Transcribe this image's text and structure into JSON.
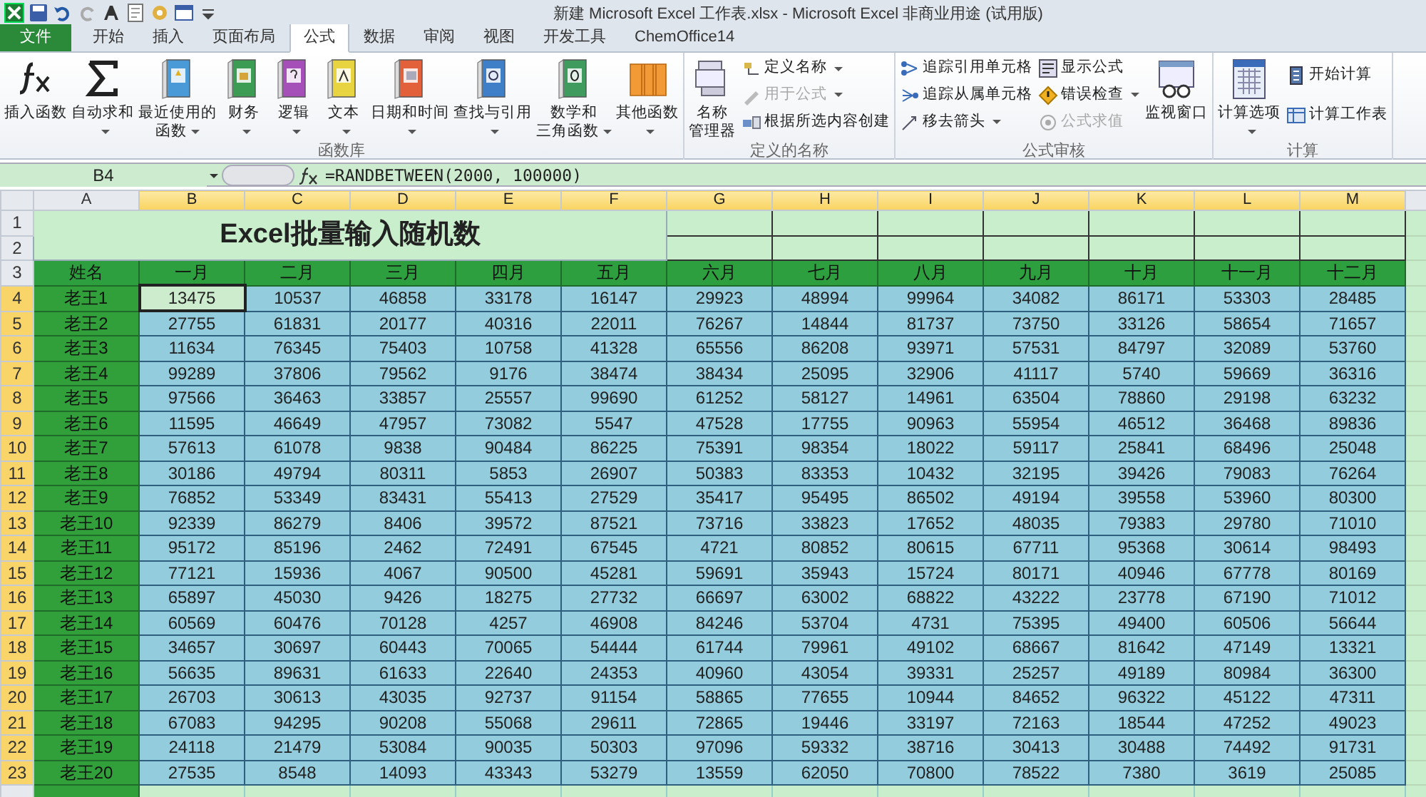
{
  "window": {
    "title": "新建 Microsoft Excel 工作表.xlsx - Microsoft Excel 非商业用途 (试用版)"
  },
  "ribbon": {
    "tabs": [
      {
        "label": "文件",
        "kind": "file",
        "selected": false
      },
      {
        "label": "开始",
        "kind": "tab",
        "selected": false
      },
      {
        "label": "插入",
        "kind": "tab",
        "selected": false
      },
      {
        "label": "页面布局",
        "kind": "tab",
        "selected": false
      },
      {
        "label": "公式",
        "kind": "tab",
        "selected": true
      },
      {
        "label": "数据",
        "kind": "tab",
        "selected": false
      },
      {
        "label": "审阅",
        "kind": "tab",
        "selected": false
      },
      {
        "label": "视图",
        "kind": "tab",
        "selected": false
      },
      {
        "label": "开发工具",
        "kind": "tab",
        "selected": false
      },
      {
        "label": "ChemOffice14",
        "kind": "tab",
        "selected": false
      }
    ],
    "groups": [
      {
        "label": "函数库",
        "commands": [
          {
            "lines": [
              "插入函数"
            ],
            "kind": "large",
            "dropdown": false,
            "disabled": false
          },
          {
            "lines": [
              "自动求和"
            ],
            "kind": "large",
            "dropdown": true,
            "disabled": false
          },
          {
            "lines": [
              "最近使用的",
              "函数"
            ],
            "kind": "large",
            "dropdown": true,
            "disabled": false
          },
          {
            "lines": [
              "财务"
            ],
            "kind": "large",
            "dropdown": true,
            "disabled": false
          },
          {
            "lines": [
              "逻辑"
            ],
            "kind": "large",
            "dropdown": true,
            "disabled": false
          },
          {
            "lines": [
              "文本"
            ],
            "kind": "large",
            "dropdown": true,
            "disabled": false
          },
          {
            "lines": [
              "日期和时间"
            ],
            "kind": "large",
            "dropdown": true,
            "disabled": false
          },
          {
            "lines": [
              "查找与引用"
            ],
            "kind": "large",
            "dropdown": true,
            "disabled": false
          },
          {
            "lines": [
              "数学和",
              "三角函数"
            ],
            "kind": "large",
            "dropdown": true,
            "disabled": false
          },
          {
            "lines": [
              "其他函数"
            ],
            "kind": "large",
            "dropdown": true,
            "disabled": false
          }
        ]
      },
      {
        "label": "定义的名称",
        "commands": [
          {
            "lines": [
              "名称",
              "管理器"
            ],
            "kind": "large",
            "dropdown": false,
            "disabled": false
          },
          {
            "label": "定义名称",
            "kind": "small",
            "dropdown": true,
            "disabled": false
          },
          {
            "label": "用于公式",
            "kind": "small",
            "dropdown": true,
            "disabled": true
          },
          {
            "label": "根据所选内容创建",
            "kind": "small",
            "dropdown": false,
            "disabled": false
          }
        ]
      },
      {
        "label": "公式审核",
        "commands": [
          {
            "label": "追踪引用单元格",
            "kind": "small",
            "dropdown": false,
            "disabled": false
          },
          {
            "label": "追踪从属单元格",
            "kind": "small",
            "dropdown": false,
            "disabled": false
          },
          {
            "label": "移去箭头",
            "kind": "small",
            "dropdown": true,
            "disabled": false
          },
          {
            "label": "显示公式",
            "kind": "small",
            "dropdown": false,
            "disabled": false
          },
          {
            "label": "错误检查",
            "kind": "small",
            "dropdown": true,
            "disabled": false
          },
          {
            "label": "公式求值",
            "kind": "small",
            "dropdown": false,
            "disabled": true
          },
          {
            "lines": [
              "监视窗口"
            ],
            "kind": "large",
            "dropdown": false,
            "disabled": false
          }
        ]
      },
      {
        "label": "计算",
        "commands": [
          {
            "lines": [
              "计算选项"
            ],
            "kind": "large",
            "dropdown": true,
            "disabled": false
          },
          {
            "label": "开始计算",
            "kind": "small",
            "dropdown": false,
            "disabled": false
          },
          {
            "label": "计算工作表",
            "kind": "small",
            "dropdown": false,
            "disabled": false
          }
        ]
      }
    ]
  },
  "formula_bar": {
    "name_box": "B4",
    "formula": "=RANDBETWEEN(2000, 100000)"
  },
  "sheet": {
    "columns": [
      {
        "label": "A",
        "selected": false
      },
      {
        "label": "B",
        "selected": true
      },
      {
        "label": "C",
        "selected": true
      },
      {
        "label": "D",
        "selected": true
      },
      {
        "label": "E",
        "selected": true
      },
      {
        "label": "F",
        "selected": true
      },
      {
        "label": "G",
        "selected": true
      },
      {
        "label": "H",
        "selected": true
      },
      {
        "label": "I",
        "selected": true
      },
      {
        "label": "J",
        "selected": true
      },
      {
        "label": "K",
        "selected": true
      },
      {
        "label": "L",
        "selected": true
      },
      {
        "label": "M",
        "selected": true
      }
    ],
    "title_rows": [
      {
        "number": "1",
        "selected": false
      },
      {
        "number": "2",
        "selected": false
      }
    ],
    "title": "Excel批量输入随机数",
    "header_row": {
      "number": "3",
      "selected": false,
      "cells": [
        "姓名",
        "一月",
        "二月",
        "三月",
        "四月",
        "五月",
        "六月",
        "七月",
        "八月",
        "九月",
        "十月",
        "十一月",
        "十二月"
      ]
    },
    "data_rows": [
      {
        "number": "4",
        "selected": true,
        "cells": [
          "老王1",
          "13475",
          "10537",
          "46858",
          "33178",
          "16147",
          "29923",
          "48994",
          "99964",
          "34082",
          "86171",
          "53303",
          "28485"
        ]
      },
      {
        "number": "5",
        "selected": true,
        "cells": [
          "老王2",
          "27755",
          "61831",
          "20177",
          "40316",
          "22011",
          "76267",
          "14844",
          "81737",
          "73750",
          "33126",
          "58654",
          "71657"
        ]
      },
      {
        "number": "6",
        "selected": true,
        "cells": [
          "老王3",
          "11634",
          "76345",
          "75403",
          "10758",
          "41328",
          "65556",
          "86208",
          "93971",
          "57531",
          "84797",
          "32089",
          "53760"
        ]
      },
      {
        "number": "7",
        "selected": true,
        "cells": [
          "老王4",
          "99289",
          "37806",
          "79562",
          "9176",
          "38474",
          "38434",
          "25095",
          "32906",
          "41117",
          "5740",
          "59669",
          "36316"
        ]
      },
      {
        "number": "8",
        "selected": true,
        "cells": [
          "老王5",
          "97566",
          "36463",
          "33857",
          "25557",
          "99690",
          "61252",
          "58127",
          "14961",
          "63504",
          "78860",
          "29198",
          "63232"
        ]
      },
      {
        "number": "9",
        "selected": true,
        "cells": [
          "老王6",
          "11595",
          "46649",
          "47957",
          "73082",
          "5547",
          "47528",
          "17755",
          "90963",
          "55954",
          "46512",
          "36468",
          "89836"
        ]
      },
      {
        "number": "10",
        "selected": true,
        "cells": [
          "老王7",
          "57613",
          "61078",
          "9838",
          "90484",
          "86225",
          "75391",
          "98354",
          "18022",
          "59117",
          "25841",
          "68496",
          "25048"
        ]
      },
      {
        "number": "11",
        "selected": true,
        "cells": [
          "老王8",
          "30186",
          "49794",
          "80311",
          "5853",
          "26907",
          "50383",
          "83353",
          "10432",
          "32195",
          "39426",
          "79083",
          "76264"
        ]
      },
      {
        "number": "12",
        "selected": true,
        "cells": [
          "老王9",
          "76852",
          "53349",
          "83431",
          "55413",
          "27529",
          "35417",
          "95495",
          "86502",
          "49194",
          "39558",
          "53960",
          "80300"
        ]
      },
      {
        "number": "13",
        "selected": true,
        "cells": [
          "老王10",
          "92339",
          "86279",
          "8406",
          "39572",
          "87521",
          "73716",
          "33823",
          "17652",
          "48035",
          "79383",
          "29780",
          "71010"
        ]
      },
      {
        "number": "14",
        "selected": true,
        "cells": [
          "老王11",
          "95172",
          "85196",
          "2462",
          "72491",
          "67545",
          "4721",
          "80852",
          "80615",
          "67711",
          "95368",
          "30614",
          "98493"
        ]
      },
      {
        "number": "15",
        "selected": true,
        "cells": [
          "老王12",
          "77121",
          "15936",
          "4067",
          "90500",
          "45281",
          "59691",
          "35943",
          "15724",
          "80171",
          "40946",
          "67778",
          "80169"
        ]
      },
      {
        "number": "16",
        "selected": true,
        "cells": [
          "老王13",
          "65897",
          "45030",
          "9426",
          "18275",
          "27732",
          "66697",
          "63002",
          "68822",
          "43222",
          "23778",
          "67190",
          "71012"
        ]
      },
      {
        "number": "17",
        "selected": true,
        "cells": [
          "老王14",
          "60569",
          "60476",
          "70128",
          "4257",
          "46908",
          "84246",
          "53704",
          "4731",
          "75395",
          "49400",
          "60506",
          "56644"
        ]
      },
      {
        "number": "18",
        "selected": true,
        "cells": [
          "老王15",
          "34657",
          "30697",
          "60443",
          "70065",
          "54444",
          "61744",
          "79961",
          "49102",
          "68667",
          "81642",
          "47149",
          "13321"
        ]
      },
      {
        "number": "19",
        "selected": true,
        "cells": [
          "老王16",
          "56635",
          "89631",
          "61633",
          "22640",
          "24353",
          "40960",
          "43054",
          "39331",
          "25257",
          "49189",
          "80984",
          "36300"
        ]
      },
      {
        "number": "20",
        "selected": true,
        "cells": [
          "老王17",
          "26703",
          "30613",
          "43035",
          "92737",
          "91154",
          "58865",
          "77655",
          "10944",
          "84652",
          "96322",
          "45122",
          "47311"
        ]
      },
      {
        "number": "21",
        "selected": true,
        "cells": [
          "老王18",
          "67083",
          "94295",
          "90208",
          "55068",
          "29611",
          "72865",
          "19446",
          "33197",
          "72163",
          "18544",
          "47252",
          "49023"
        ]
      },
      {
        "number": "22",
        "selected": true,
        "cells": [
          "老王19",
          "24118",
          "21479",
          "53084",
          "90035",
          "50303",
          "97096",
          "59332",
          "38716",
          "30413",
          "30488",
          "74492",
          "91731"
        ]
      },
      {
        "number": "23",
        "selected": true,
        "cells": [
          "老王20",
          "27535",
          "8548",
          "14093",
          "43343",
          "53279",
          "13559",
          "62050",
          "70800",
          "78522",
          "7380",
          "3619",
          "25085"
        ]
      }
    ]
  }
}
